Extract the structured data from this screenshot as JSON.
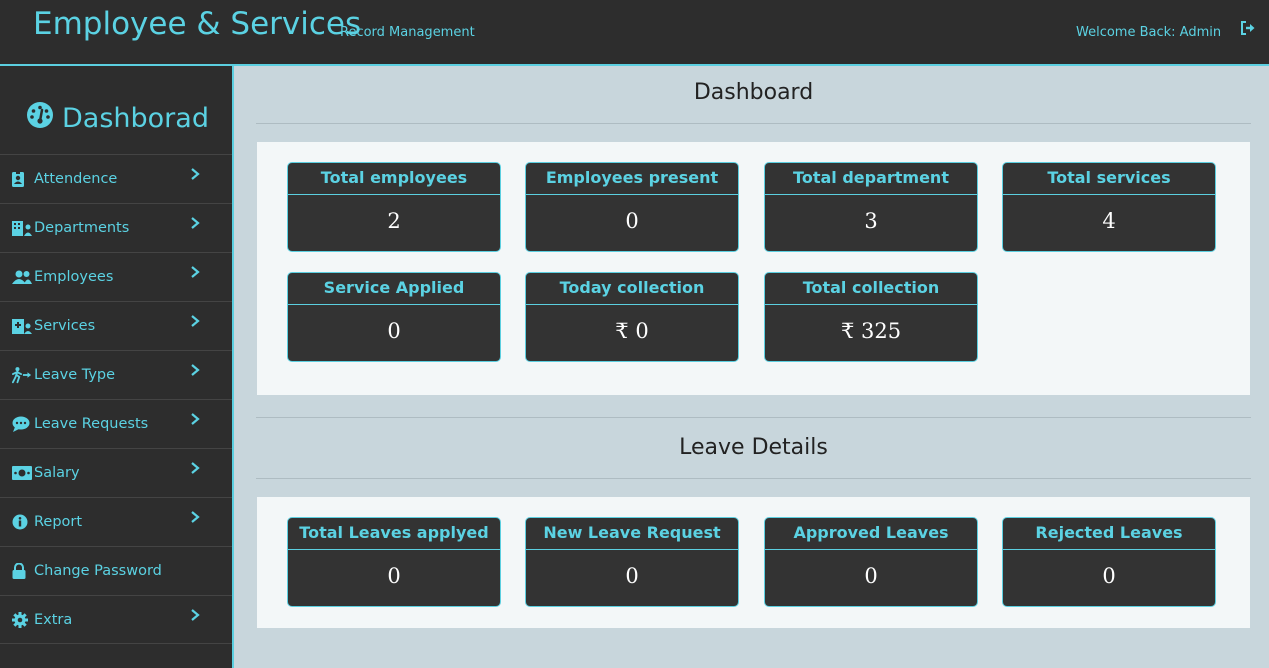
{
  "header": {
    "brand": "Employee & Services",
    "brand_sub": "Record Management",
    "welcome": "Welcome Back: Admin",
    "logout_icon": "sign-out-icon"
  },
  "sidebar": {
    "title": "Dashborad",
    "title_icon": "tachometer-icon",
    "items": [
      {
        "label": "Attendence",
        "icon": "id-badge-icon",
        "has_chevron": true
      },
      {
        "label": "Departments",
        "icon": "building-user-icon",
        "has_chevron": true
      },
      {
        "label": "Employees",
        "icon": "users-icon",
        "has_chevron": true
      },
      {
        "label": "Services",
        "icon": "hospital-user-icon",
        "has_chevron": true
      },
      {
        "label": "Leave Type",
        "icon": "person-walking-arrow-icon",
        "has_chevron": true
      },
      {
        "label": "Leave Requests",
        "icon": "comment-dots-icon",
        "has_chevron": true
      },
      {
        "label": "Salary",
        "icon": "money-bill-icon",
        "has_chevron": true
      },
      {
        "label": "Report",
        "icon": "info-circle-icon",
        "has_chevron": true
      },
      {
        "label": "Change Password",
        "icon": "lock-icon",
        "has_chevron": false
      },
      {
        "label": "Extra",
        "icon": "cog-icon",
        "has_chevron": true
      }
    ]
  },
  "dashboard": {
    "title": "Dashboard",
    "cards": [
      {
        "label": "Total employees",
        "value": "2"
      },
      {
        "label": "Employees present",
        "value": "0"
      },
      {
        "label": "Total department",
        "value": "3"
      },
      {
        "label": "Total services",
        "value": "4"
      },
      {
        "label": "Service Applied",
        "value": "0"
      },
      {
        "label": "Today collection",
        "value": "₹ 0"
      },
      {
        "label": "Total collection",
        "value": "₹ 325"
      }
    ]
  },
  "leave": {
    "title": "Leave Details",
    "cards": [
      {
        "label": "Total Leaves applyed",
        "value": "0"
      },
      {
        "label": "New Leave Request",
        "value": "0"
      },
      {
        "label": "Approved Leaves",
        "value": "0"
      },
      {
        "label": "Rejected Leaves",
        "value": "0"
      }
    ]
  },
  "colors": {
    "accent": "#5bd2e3",
    "dark": "#2d2d2d",
    "card": "#333333",
    "background": "#c8d6dc",
    "panel": "#f3f7f8"
  }
}
